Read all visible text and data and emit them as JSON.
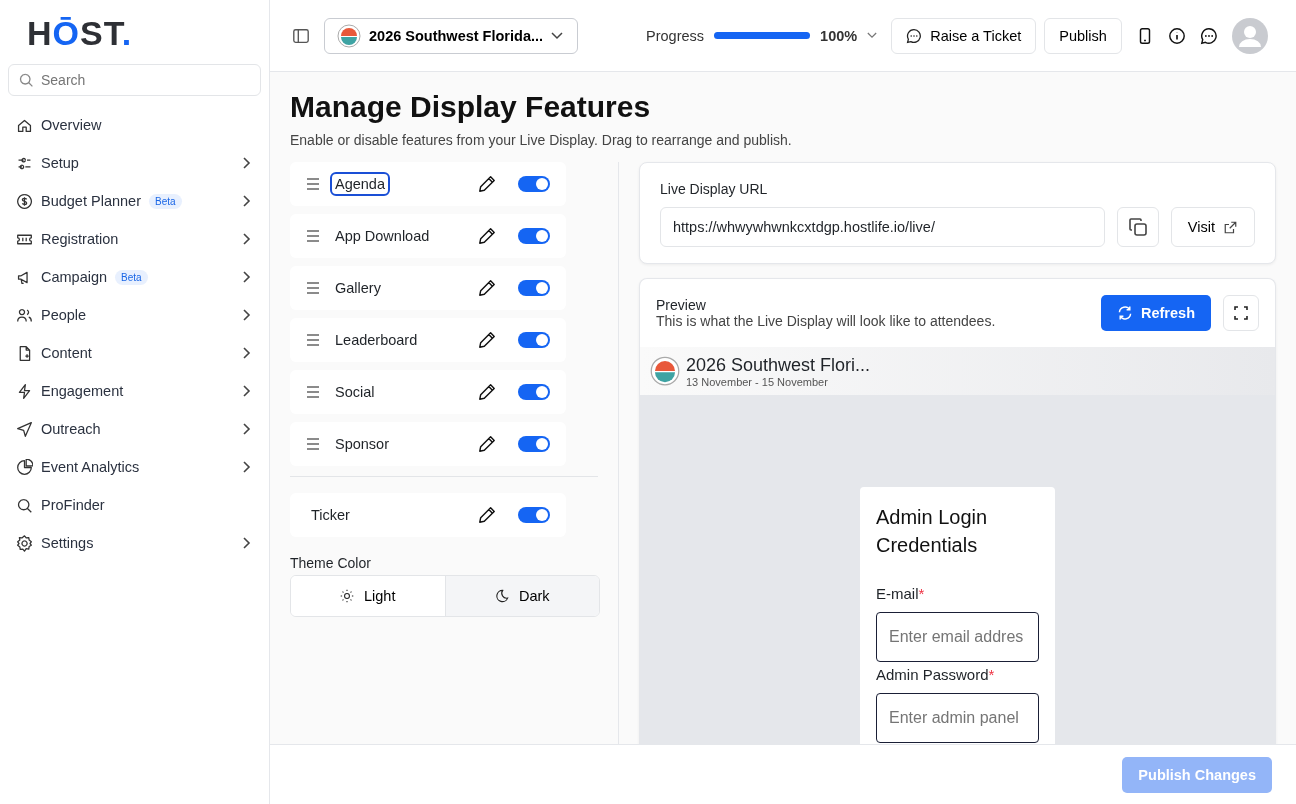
{
  "logo": {
    "text": "HŌST."
  },
  "search": {
    "placeholder": "Search"
  },
  "nav": [
    {
      "label": "Overview",
      "chevron": false
    },
    {
      "label": "Setup",
      "chevron": true
    },
    {
      "label": "Budget Planner",
      "badge": "Beta",
      "chevron": true
    },
    {
      "label": "Registration",
      "chevron": true
    },
    {
      "label": "Campaign",
      "badge": "Beta",
      "chevron": true
    },
    {
      "label": "People",
      "chevron": true
    },
    {
      "label": "Content",
      "chevron": true
    },
    {
      "label": "Engagement",
      "chevron": true
    },
    {
      "label": "Outreach",
      "chevron": true
    },
    {
      "label": "Event Analytics",
      "chevron": true
    },
    {
      "label": "ProFinder",
      "chevron": false
    },
    {
      "label": "Settings",
      "chevron": true
    }
  ],
  "topbar": {
    "event": "2026 Southwest Florida...",
    "progress_label": "Progress",
    "progress": {
      "level": 1.0
    },
    "progress_value": "100%",
    "buttons": [
      "Raise a Ticket",
      "Publish"
    ]
  },
  "page": {
    "title": "Manage Display Features",
    "subtitle": "Enable or disable features from your Live Display. Drag to rearrange and publish."
  },
  "features": [
    {
      "label": "Agenda",
      "on": true,
      "focused": true
    },
    {
      "label": "App Download",
      "on": true,
      "focused": false
    },
    {
      "label": "Gallery",
      "on": true,
      "focused": false
    },
    {
      "label": "Leaderboard",
      "on": true,
      "focused": false
    },
    {
      "label": "Social",
      "on": true,
      "focused": false
    },
    {
      "label": "Sponsor",
      "on": true,
      "focused": false
    }
  ],
  "ticker": {
    "label": "Ticker",
    "on": true
  },
  "theme": {
    "label": "Theme Color",
    "options": [
      {
        "label": "Light",
        "selected": true
      },
      {
        "label": "Dark",
        "selected": false
      }
    ]
  },
  "url_card": {
    "label": "Live Display URL",
    "value": "https://whwywhwnkcxtdgp.hostlife.io/live/",
    "visit": "Visit"
  },
  "preview": {
    "title": "Preview",
    "subtitle": "This is what the Live Display will look like to attendees.",
    "refresh": "Refresh",
    "event_title": "2026 Southwest Flori...",
    "dates": "13 November - 15 November",
    "login": {
      "title": "Admin Login Credentials",
      "fields": [
        {
          "label": "E-mail",
          "required_mark": "*",
          "placeholder": "Enter email addres"
        },
        {
          "label": "Admin Password",
          "required_mark": "*",
          "placeholder": "Enter admin panel"
        }
      ]
    }
  },
  "footer": {
    "button": "Publish Changes",
    "disabled": true
  }
}
